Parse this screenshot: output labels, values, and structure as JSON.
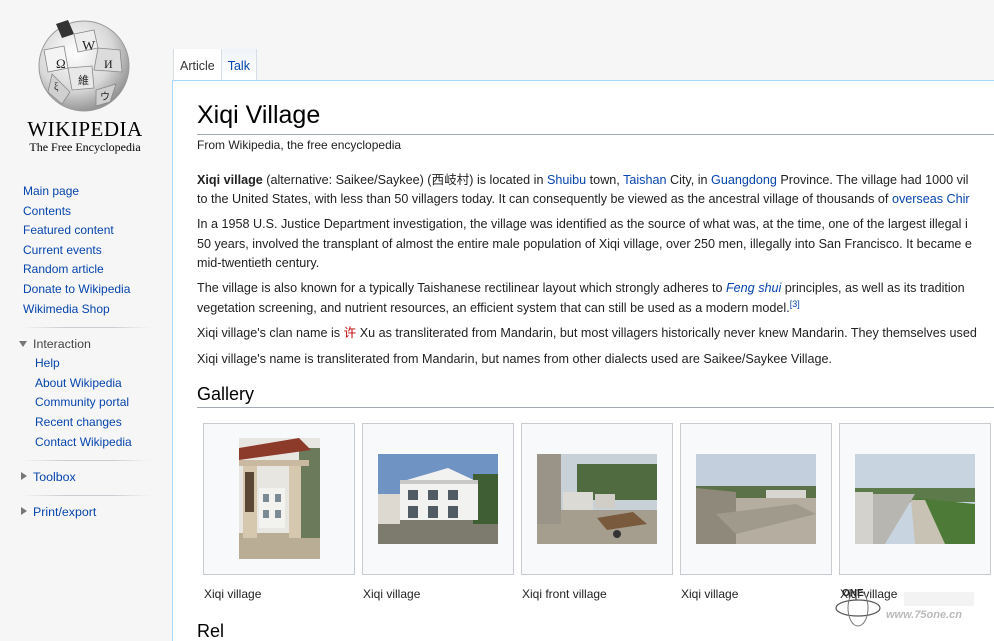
{
  "logo": {
    "wordmark": "WIKIPEDIA",
    "tagline": "The Free Encyclopedia"
  },
  "navigation": [
    {
      "label": "Main page"
    },
    {
      "label": "Contents"
    },
    {
      "label": "Featured content"
    },
    {
      "label": "Current events"
    },
    {
      "label": "Random article"
    },
    {
      "label": "Donate to Wikipedia"
    },
    {
      "label": "Wikimedia Shop"
    }
  ],
  "interaction": {
    "heading": "Interaction",
    "items": [
      {
        "label": "Help"
      },
      {
        "label": "About Wikipedia"
      },
      {
        "label": "Community portal"
      },
      {
        "label": "Recent changes"
      },
      {
        "label": "Contact Wikipedia"
      }
    ]
  },
  "toolbox": {
    "heading": "Toolbox"
  },
  "printexport": {
    "heading": "Print/export"
  },
  "tabs": [
    {
      "label": "Article"
    },
    {
      "label": "Talk"
    }
  ],
  "article": {
    "title": "Xiqi Village",
    "site_sub": "From Wikipedia, the free encyclopedia",
    "p1": {
      "bold": "Xiqi village",
      "a": " (alternative: Saikee/Saykee) (西岐村) is located in ",
      "link_shuibu": "Shuibu",
      "b": " town, ",
      "link_taishan": "Taishan",
      "c": " City, in ",
      "link_guangdong": "Guangdong",
      "d": " Province. The village had 1000 vil",
      "line2": "to the United States, with less than 50 villagers today. It can consequently be viewed as the ancestral village of thousands of ",
      "link_overseas": "overseas Chir"
    },
    "p2": {
      "line1": "In a 1958 U.S. Justice Department investigation, the village was identified as the source of what was, at the time, one of the largest illegal i",
      "line2": "50 years, involved the transplant of almost the entire male population of Xiqi village, over 250 men, illegally into San Francisco. It became e",
      "line3": "mid-twentieth century."
    },
    "p3": {
      "a": "The village is also known for a typically Taishanese rectilinear layout which strongly adheres to ",
      "link_fengshui": "Feng shui",
      "b": " principles, as well as its tradition",
      "line2": "vegetation screening, and nutrient resources, an efficient system that can still be used as a modern model.",
      "ref": "[3]"
    },
    "p4": {
      "a": "Xiqi village's clan name is ",
      "link_xu": "许",
      "b": " Xu as transliterated from Mandarin, but most villagers historically never knew Mandarin. They themselves used"
    },
    "p5": "Xiqi village's name is transliterated from Mandarin, but names from other dialects used are Saikee/Saykee Village.",
    "gallery_heading": "Gallery",
    "gallery": [
      {
        "caption": "Xiqi village"
      },
      {
        "caption": "Xiqi village"
      },
      {
        "caption": "Xiqi front village"
      },
      {
        "caption": "Xiqi village"
      },
      {
        "caption": "Xiqi village"
      }
    ],
    "next_heading": "Rel"
  },
  "watermark": {
    "logo_text": "ONE",
    "url": "www.75one.cn"
  },
  "colors": {
    "link": "#0645ad",
    "border_blue": "#a7d7f9",
    "chinese_link": "#ba0000"
  }
}
